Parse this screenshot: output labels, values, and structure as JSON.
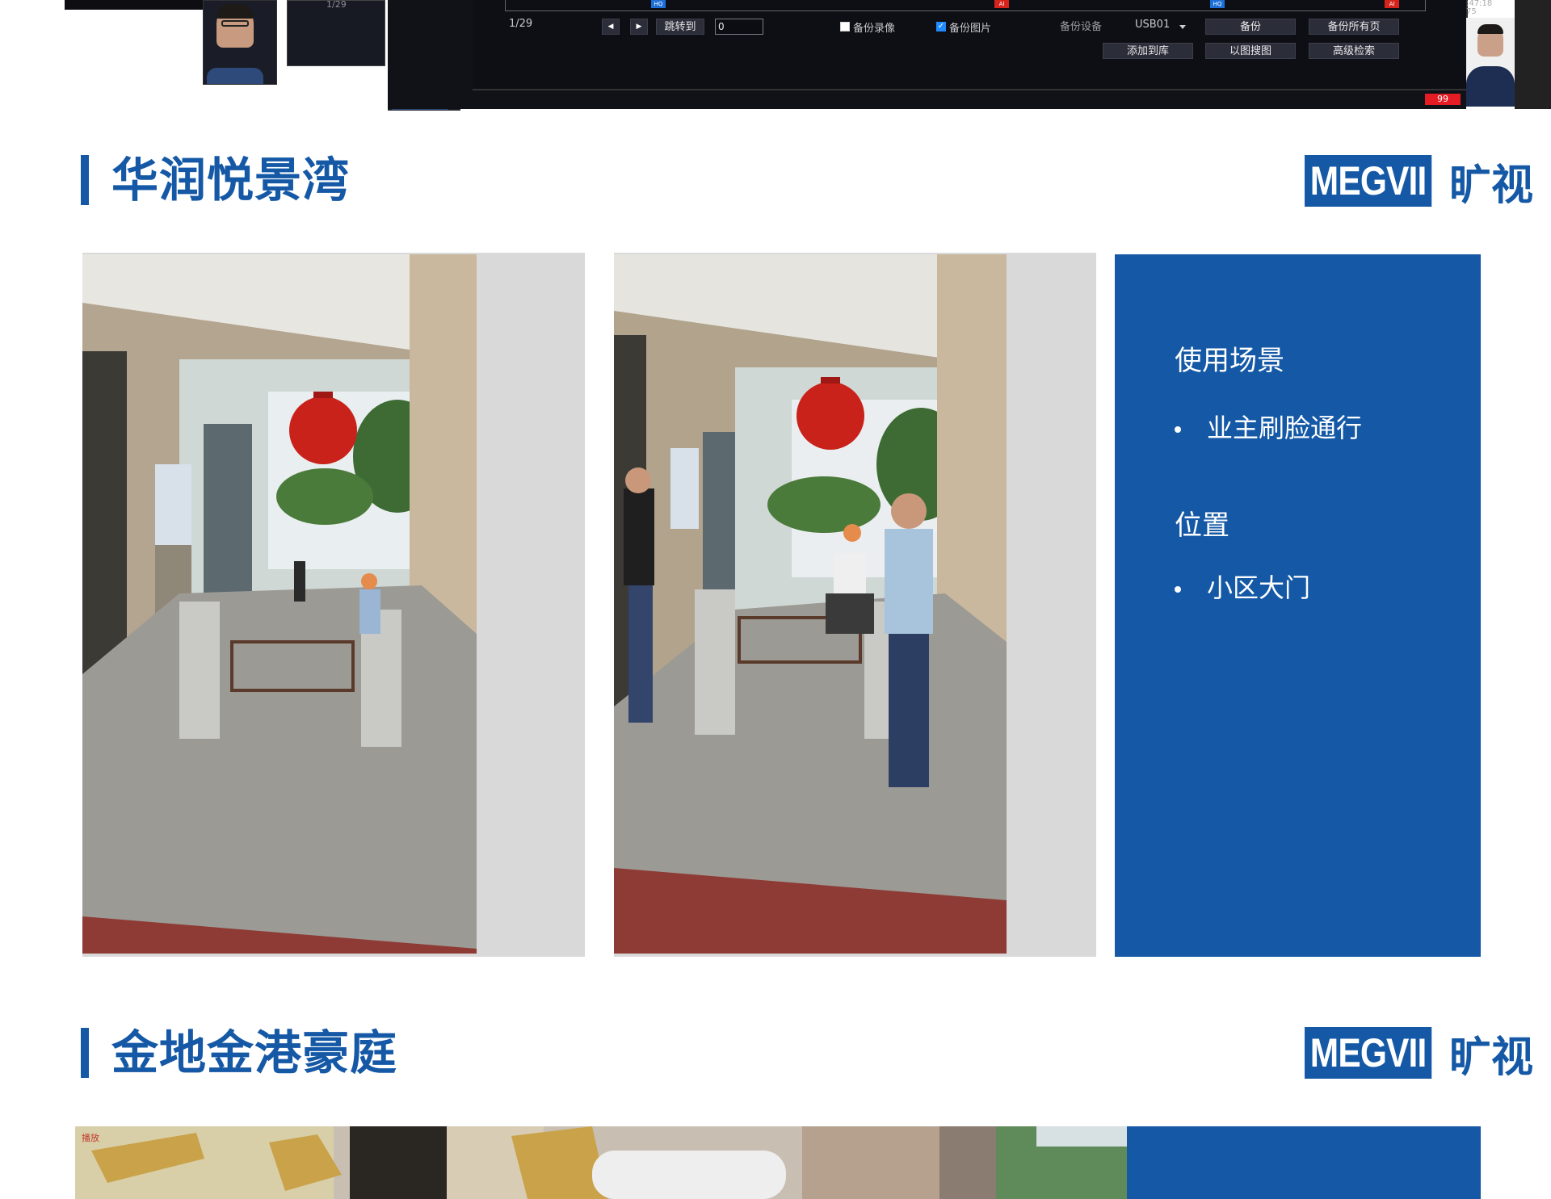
{
  "dvr": {
    "mini_page": "1/29",
    "page_indicator": "1/29",
    "jump_label": "跳转到",
    "jump_value": "0",
    "backup_record_label": "备份录像",
    "backup_image_label": "备份图片",
    "backup_device_label": "备份设备",
    "device_value": "USB01",
    "buttons": {
      "backup": "备份",
      "backup_all": "备份所有页",
      "add_to_library": "添加到库",
      "search_by_image": "以图搜图",
      "advanced_search": "高级检索"
    },
    "tags": [
      "HQ",
      "AI",
      "HQ",
      "AI"
    ],
    "corner_text": ":47:18\n75",
    "badge": "99"
  },
  "section1": {
    "title": "华润悦景湾",
    "logo_text": "MEGVII",
    "logo_cn": "旷视",
    "info": {
      "heading1": "使用场景",
      "bullet1": "业主刷脸通行",
      "heading2": "位置",
      "bullet2": "小区大门"
    }
  },
  "section2": {
    "title": "金地金港豪庭",
    "logo_text": "MEGVII",
    "logo_cn": "旷视",
    "photo_tag": "播放"
  },
  "colors": {
    "brand_blue": "#1559a6"
  }
}
